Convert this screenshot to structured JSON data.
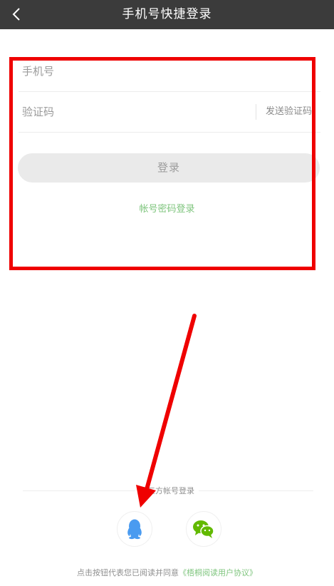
{
  "header": {
    "title": "手机号快捷登录",
    "back_icon": "chevron-left-icon"
  },
  "form": {
    "phone_placeholder": "手机号",
    "code_placeholder": "验证码",
    "send_code_label": "发送验证码",
    "login_label": "登录",
    "password_login_label": "帐号密码登录"
  },
  "third_party": {
    "label": "第三方帐号登录",
    "providers": [
      {
        "name": "QQ",
        "icon": "qq-icon",
        "color": "#4a9bf0"
      },
      {
        "name": "WeChat",
        "icon": "wechat-icon",
        "color": "#62b900"
      }
    ]
  },
  "agreement": {
    "prefix": "点击按钮代表您已阅读并同意",
    "link": "《梧桐阅读用户协议》"
  },
  "colors": {
    "topbar": "#3b3b3b",
    "accent_green": "#7fc57e",
    "annotation_red": "#ef0000"
  }
}
